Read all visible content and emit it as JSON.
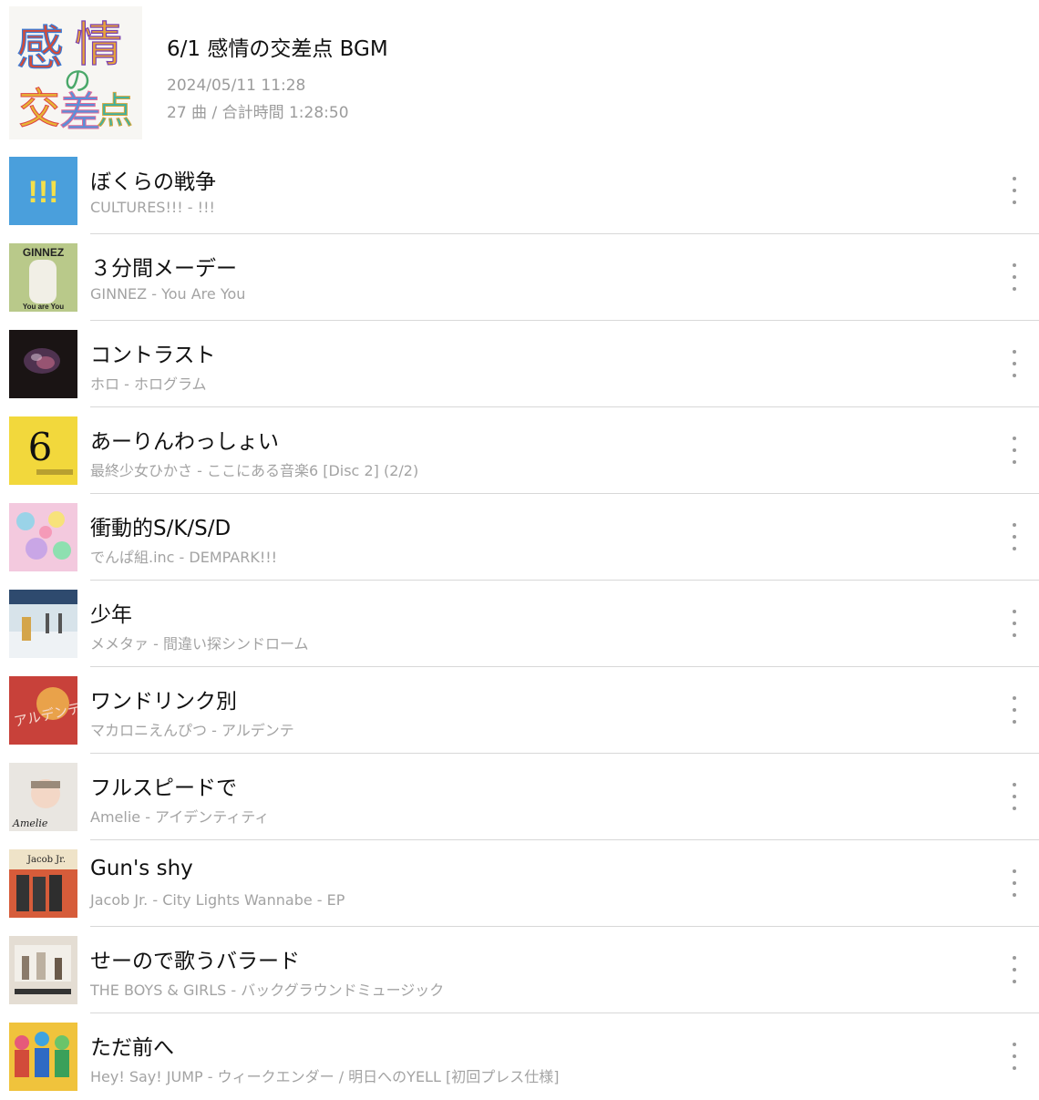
{
  "playlist": {
    "cover_text": [
      "感",
      "情",
      "の",
      "交",
      "差",
      "点"
    ],
    "title": "6/1 感情の交差点 BGM",
    "date": "2024/05/11 11:28",
    "meta": "27 曲 / 合計時間 1:28:50"
  },
  "tracks": [
    {
      "title": "ぼくらの戦争",
      "subtitle": "CULTURES!!! - !!!",
      "art_text": "!!!",
      "art_color": "#4a9fdc"
    },
    {
      "title": "３分間メーデー",
      "subtitle": "GINNEZ - You Are You",
      "art_text": "GINNEZ",
      "art_caption": "You are You",
      "art_color": "#b9c98a"
    },
    {
      "title": "コントラスト",
      "subtitle": "ホロ - ホログラム",
      "art_color": "#1a1414"
    },
    {
      "title": "あーりんわっしょい",
      "subtitle": "最終少女ひかさ - ここにある音楽6 [Disc 2] (2/2)",
      "art_text": "6",
      "art_color": "#f2d83c"
    },
    {
      "title": "衝動的S/K/S/D",
      "subtitle": "でんぱ組.inc - DEMPARK!!!",
      "art_color": "#f3c9de"
    },
    {
      "title": "少年",
      "subtitle": "メメタァ - 間違い探シンドローム",
      "art_color": "#d7e3ea"
    },
    {
      "title": "ワンドリンク別",
      "subtitle": "マカロニえんぴつ - アルデンテ",
      "art_text": "アルデンテ",
      "art_color": "#c8413a"
    },
    {
      "title": "フルスピードで",
      "subtitle": "Amelie - アイデンティティ",
      "art_caption": "Amelie",
      "art_color": "#e9e6e1"
    },
    {
      "title": "Gun's shy",
      "subtitle": "Jacob Jr. - City Lights Wannabe - EP",
      "art_text": "Jacob Jr.",
      "art_color": "#d65c3a"
    },
    {
      "title": "せーので歌うバラード",
      "subtitle": "THE BOYS & GIRLS - バックグラウンドミュージック",
      "art_color": "#e4ddd3"
    },
    {
      "title": "ただ前へ",
      "subtitle": "Hey! Say! JUMP - ウィークエンダー / 明日へのYELL [初回プレス仕様]",
      "art_color": "#f0c33c"
    }
  ],
  "icons": {
    "more": "more-vertical-icon"
  }
}
